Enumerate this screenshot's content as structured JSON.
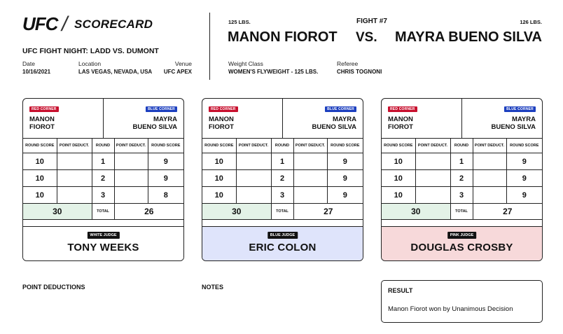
{
  "header": {
    "logo": "UFC",
    "title": "SCORECARD",
    "event_name": "UFC FIGHT NIGHT: LADD VS. DUMONT",
    "date_label": "Date",
    "date_value": "10/16/2021",
    "location_label": "Location",
    "location_value": "LAS VEGAS, NEVADA, USA",
    "venue_label": "Venue",
    "venue_value": "UFC APEX"
  },
  "fight": {
    "red_weight": "125 LBS.",
    "fight_number": "FIGHT #7",
    "blue_weight": "126 LBS.",
    "red_fighter": "MANON FIOROT",
    "vs": "VS.",
    "blue_fighter": "MAYRA BUENO SILVA",
    "weight_class_label": "Weight Class",
    "weight_class_value": "WOMEN'S FLYWEIGHT - 125 LBS.",
    "referee_label": "Referee",
    "referee_value": "CHRIS TOGNONI"
  },
  "card_labels": {
    "red_corner": "RED CORNER",
    "blue_corner": "BLUE CORNER",
    "red_first": "MANON",
    "red_last": "FIOROT",
    "blue_first": "MAYRA",
    "blue_last": "BUENO SILVA",
    "round_score": "ROUND SCORE",
    "point_deduct": "POINT DEDUCT.",
    "round": "ROUND",
    "total": "TOTAL"
  },
  "cards": [
    {
      "judge_type": "WHITE JUDGE",
      "judge_name": "TONY WEEKS",
      "rounds": [
        {
          "round": "1",
          "red": "10",
          "blue": "9"
        },
        {
          "round": "2",
          "red": "10",
          "blue": "9"
        },
        {
          "round": "3",
          "red": "10",
          "blue": "8"
        }
      ],
      "red_total": "30",
      "blue_total": "26"
    },
    {
      "judge_type": "BLUE JUDGE",
      "judge_name": "ERIC COLON",
      "rounds": [
        {
          "round": "1",
          "red": "10",
          "blue": "9"
        },
        {
          "round": "2",
          "red": "10",
          "blue": "9"
        },
        {
          "round": "3",
          "red": "10",
          "blue": "9"
        }
      ],
      "red_total": "30",
      "blue_total": "27"
    },
    {
      "judge_type": "PINK JUDGE",
      "judge_name": "DOUGLAS CROSBY",
      "rounds": [
        {
          "round": "1",
          "red": "10",
          "blue": "9"
        },
        {
          "round": "2",
          "red": "10",
          "blue": "9"
        },
        {
          "round": "3",
          "red": "10",
          "blue": "9"
        }
      ],
      "red_total": "30",
      "blue_total": "27"
    }
  ],
  "bottom": {
    "point_deductions_title": "POINT DEDUCTIONS",
    "notes_title": "NOTES",
    "result_title": "RESULT",
    "result_text": "Manon Fiorot won by Unanimous Decision"
  },
  "colors": {
    "red_corner": "#c8102e",
    "blue_corner": "#1c3fbf",
    "total_highlight": "#e3f2e7",
    "blue_judge_bg": "#dfe4fb",
    "pink_judge_bg": "#f7d9da"
  }
}
